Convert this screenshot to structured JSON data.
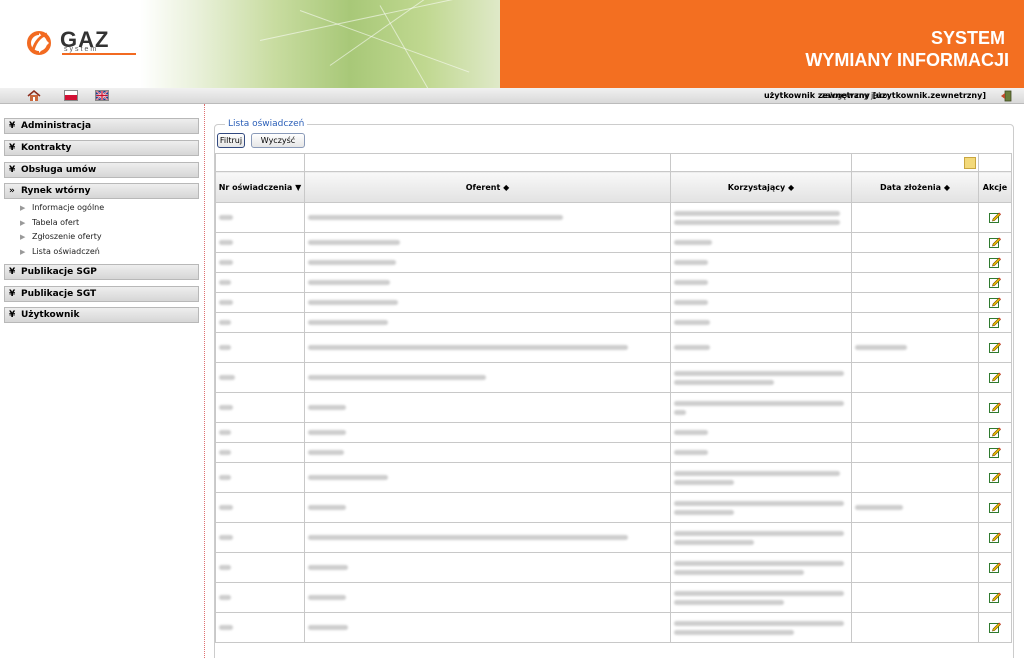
{
  "header": {
    "logo_text": "GAZ",
    "logo_sub": "system",
    "title_line1": "SYSTEM",
    "title_line2": "WYMIANY INFORMACJI",
    "brand_color": "#f36f21"
  },
  "toolbar": {
    "icons": [
      "home-icon",
      "flag-pl-icon",
      "flag-uk-icon"
    ],
    "login_label": "zalogowany jako:",
    "login_user": "użytkownik zewnętrzny [uzytkownik.zewnetrzny]"
  },
  "sidebar": {
    "sections": [
      {
        "label": "Administracja",
        "expanded": false
      },
      {
        "label": "Kontrakty",
        "expanded": false
      },
      {
        "label": "Obsługa umów",
        "expanded": false
      },
      {
        "label": "Rynek wtórny",
        "expanded": true
      },
      {
        "label": "Publikacje SGP",
        "expanded": false
      },
      {
        "label": "Publikacje SGT",
        "expanded": false
      },
      {
        "label": "Użytkownik",
        "expanded": false
      }
    ],
    "sub_items": [
      "Informacje ogólne",
      "Tabela ofert",
      "Zgłoszenie oferty",
      "Lista oświadczeń"
    ]
  },
  "main": {
    "legend": "Lista oświadczeń",
    "filter_button": "Filtruj",
    "clear_button": "Wyczyść",
    "columns": [
      "Nr oświadczenia",
      "Oferent",
      "Korzystający",
      "Data złożenia",
      "Akcje"
    ],
    "sort_icons": [
      "▼",
      "◆",
      "◆",
      "◆"
    ]
  }
}
